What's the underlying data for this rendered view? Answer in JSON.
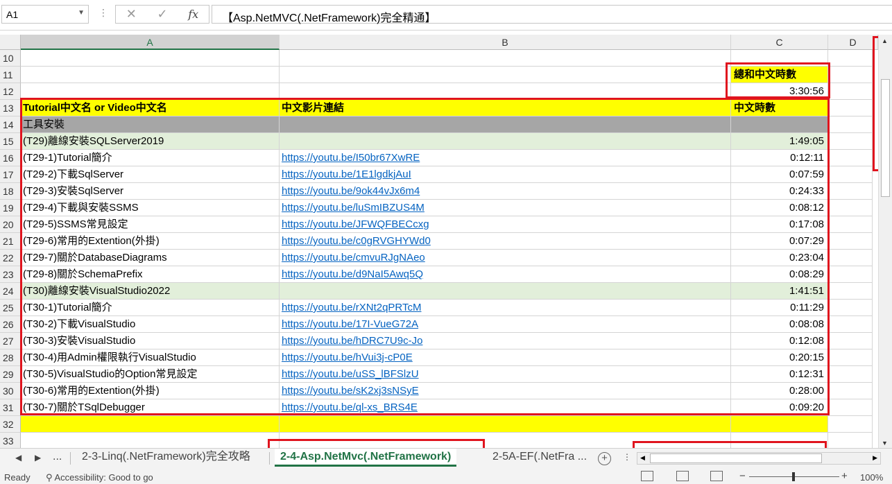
{
  "formula_bar": {
    "name_box": "A1",
    "formula": "【Asp.NetMVC(.NetFramework)完全精通】"
  },
  "columns": [
    "A",
    "B",
    "C",
    "D"
  ],
  "summary": {
    "label": "總和中文時數",
    "value": "3:30:56"
  },
  "headers": {
    "a": "Tutorial中文名 or Video中文名",
    "b": "中文影片連結",
    "c": "中文時數"
  },
  "rows": [
    {
      "num": "10",
      "a": "",
      "b": "",
      "c": ""
    },
    {
      "num": "11",
      "a": "",
      "b": "",
      "c": ""
    },
    {
      "num": "12",
      "a": "",
      "b": "",
      "c": ""
    },
    {
      "num": "13",
      "a": "",
      "b": "",
      "c": ""
    },
    {
      "num": "14",
      "a": "工具安裝",
      "b": "",
      "c": ""
    },
    {
      "num": "15",
      "a": "(T29)離線安裝SQLServer2019",
      "b": "",
      "c": "1:49:05"
    },
    {
      "num": "16",
      "a": "(T29-1)Tutorial簡介",
      "b": "https://youtu.be/I50br67XwRE",
      "c": "0:12:11"
    },
    {
      "num": "17",
      "a": "(T29-2)下載SqlServer",
      "b": "https://youtu.be/1E1lgdkjAuI",
      "c": "0:07:59"
    },
    {
      "num": "18",
      "a": "(T29-3)安裝SqlServer",
      "b": "https://youtu.be/9ok44vJx6m4",
      "c": "0:24:33"
    },
    {
      "num": "19",
      "a": "(T29-4)下載與安裝SSMS",
      "b": "https://youtu.be/luSmIBZUS4M",
      "c": "0:08:12"
    },
    {
      "num": "20",
      "a": "(T29-5)SSMS常見設定",
      "b": "https://youtu.be/JFWQFBECcxg",
      "c": "0:17:08"
    },
    {
      "num": "21",
      "a": "(T29-6)常用的Extention(外掛)",
      "b": "https://youtu.be/c0gRVGHYWd0",
      "c": "0:07:29"
    },
    {
      "num": "22",
      "a": "(T29-7)關於DatabaseDiagrams",
      "b": "https://youtu.be/cmvuRJgNAeo",
      "c": "0:23:04"
    },
    {
      "num": "23",
      "a": "(T29-8)關於SchemaPrefix",
      "b": "https://youtu.be/d9NaI5Awq5Q",
      "c": "0:08:29"
    },
    {
      "num": "24",
      "a": "(T30)離線安裝VisualStudio2022",
      "b": "",
      "c": "1:41:51"
    },
    {
      "num": "25",
      "a": "(T30-1)Tutorial簡介",
      "b": "https://youtu.be/rXNt2qPRTcM",
      "c": "0:11:29"
    },
    {
      "num": "26",
      "a": "(T30-2)下載VisualStudio",
      "b": "https://youtu.be/17I-VueG72A",
      "c": "0:08:08"
    },
    {
      "num": "27",
      "a": "(T30-3)安裝VisualStudio",
      "b": "https://youtu.be/hDRC7U9c-Jo",
      "c": "0:12:08"
    },
    {
      "num": "28",
      "a": "(T30-4)用Admin權限執行VisualStudio",
      "b": "https://youtu.be/hVui3j-cP0E",
      "c": "0:20:15"
    },
    {
      "num": "29",
      "a": "(T30-5)VisualStudio的Option常見設定",
      "b": "https://youtu.be/uSS_lBFSlzU",
      "c": "0:12:31"
    },
    {
      "num": "30",
      "a": "(T30-6)常用的Extention(外掛)",
      "b": "https://youtu.be/sK2xj3sNSyE",
      "c": "0:28:00"
    },
    {
      "num": "31",
      "a": "(T30-7)關於TSqlDebugger",
      "b": "https://youtu.be/ql-xs_BRS4E",
      "c": "0:09:20"
    },
    {
      "num": "32",
      "a": "",
      "b": "",
      "c": ""
    },
    {
      "num": "33",
      "a": "",
      "b": "",
      "c": ""
    }
  ],
  "sheet_tabs": {
    "ellipsis": "...",
    "prev": "2-3-Linq(.NetFramework)完全攻略",
    "active": "2-4-Asp.NetMvc(.NetFramework)",
    "next": "2-5A-EF(.NetFra ..."
  },
  "status_bar": {
    "ready": "Ready",
    "accessibility": "Accessibility: Good to go",
    "zoom": "100%"
  },
  "colors": {
    "excel_green": "#217346",
    "highlight_yellow": "#ffff00",
    "section_gray": "#a6a6a6",
    "group_green": "#e2efda",
    "link": "#0563c1",
    "annotation_red": "#e0141e"
  }
}
